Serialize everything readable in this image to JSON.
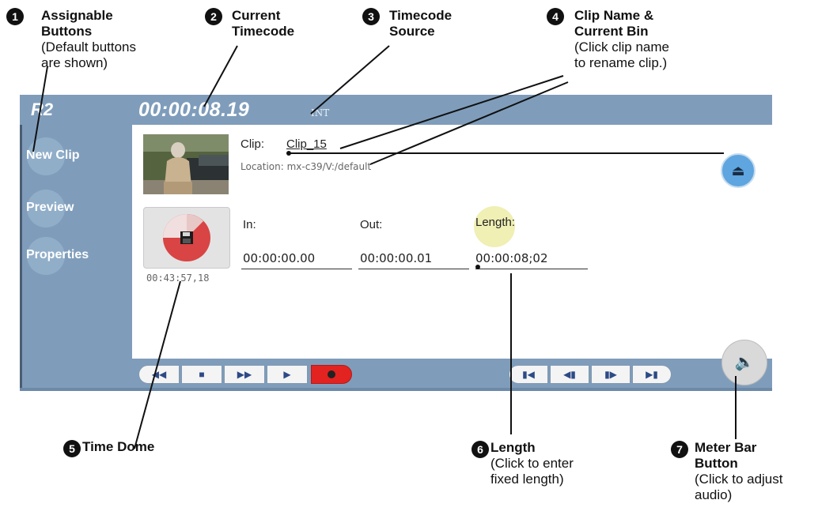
{
  "callouts": [
    {
      "num": "1",
      "title": "Assignable\nButtons",
      "sub": "(Default buttons\nare shown)"
    },
    {
      "num": "2",
      "title": "Current\nTimecode",
      "sub": ""
    },
    {
      "num": "3",
      "title": "Timecode\nSource",
      "sub": ""
    },
    {
      "num": "4",
      "title": "Clip  Name  &\nCurrent  Bin",
      "sub": "(Click clip name\nto rename clip.)"
    },
    {
      "num": "5",
      "title": "Time  Dome",
      "sub": ""
    },
    {
      "num": "6",
      "title": "Length",
      "sub": "(Click to enter\nfixed length)"
    },
    {
      "num": "7",
      "title": "Meter  Bar\nButton",
      "sub": "(Click to adjust\naudio)"
    }
  ],
  "header": {
    "channel": "R2",
    "current_timecode": "00:00:08.19",
    "timecode_source": "INT"
  },
  "sidebar": {
    "items": [
      {
        "label": "New Clip"
      },
      {
        "label": "Preview"
      },
      {
        "label": "Properties"
      }
    ]
  },
  "clip": {
    "label": "Clip:",
    "name": "Clip_15",
    "location": "Location: mx-c39/V:/default"
  },
  "time_dome": {
    "value": "00:43:57,18",
    "icon": "floppy-disk-icon"
  },
  "fields": {
    "in_label": "In:",
    "in_value": "00:00:00.00",
    "out_label": "Out:",
    "out_value": "00:00:00.01",
    "length_label": "Length:",
    "length_value": "00:00:08;02"
  },
  "transport": {
    "left_buttons": [
      "rewind-icon",
      "stop-icon",
      "fast-forward-icon",
      "play-icon",
      "record-icon"
    ],
    "right_buttons": [
      "go-to-start-icon",
      "step-back-icon",
      "step-forward-icon",
      "go-to-end-icon"
    ]
  },
  "colors": {
    "chrome": "#7f9dbb",
    "eject": "#5fa5e0",
    "record": "#e32320",
    "dome": "#d94444",
    "length_highlight": "#f0efb4"
  }
}
